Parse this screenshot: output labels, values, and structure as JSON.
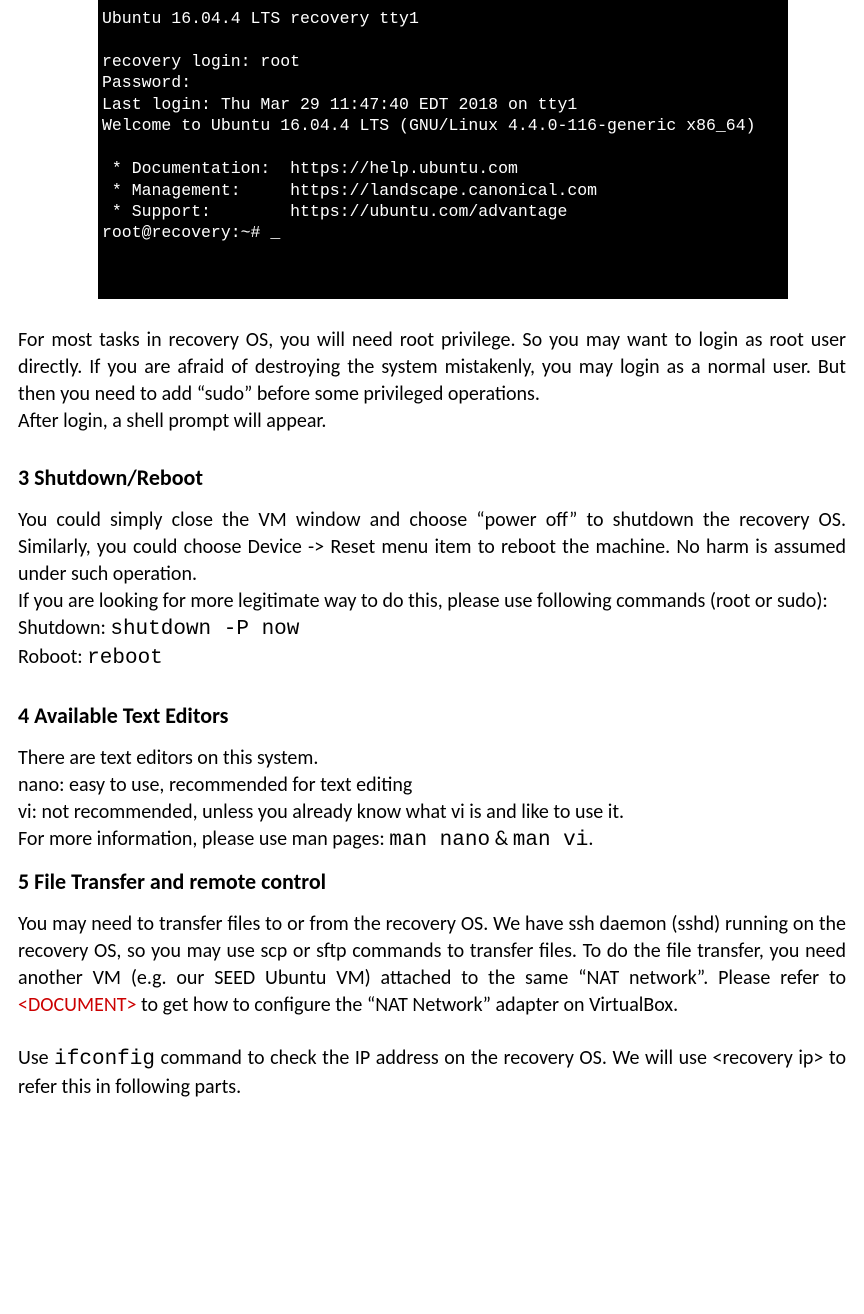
{
  "terminal": "Ubuntu 16.04.4 LTS recovery tty1\n\nrecovery login: root\nPassword:\nLast login: Thu Mar 29 11:47:40 EDT 2018 on tty1\nWelcome to Ubuntu 16.04.4 LTS (GNU/Linux 4.4.0-116-generic x86_64)\n\n * Documentation:  https://help.ubuntu.com\n * Management:     https://landscape.canonical.com\n * Support:        https://ubuntu.com/advantage\nroot@recovery:~# _",
  "intro_p1": "For most tasks in recovery OS, you will need root privilege. So you may want to login as root user directly. If you are afraid of destroying the system mistakenly, you may login as a normal user. But then you need to add “sudo” before some privileged operations.",
  "intro_p2": "After login, a shell prompt will appear.",
  "sec3": {
    "heading": "3 Shutdown/Reboot",
    "p1": "You could simply close the VM window and choose “power off” to shutdown the recovery OS. Similarly, you could choose Device -> Reset menu item to reboot the machine. No harm is assumed under such operation.",
    "p2": "If you are looking for more legitimate way to do this, please use following commands (root or sudo):",
    "shutdown_label": "Shutdown: ",
    "shutdown_cmd": "shutdown -P now",
    "reboot_label": "Roboot: ",
    "reboot_cmd": "reboot"
  },
  "sec4": {
    "heading": "4 Available Text Editors",
    "p1": "There are text editors on this system.",
    "p2": "nano: easy to use, recommended for text editing",
    "p3": "vi: not recommended, unless you already know what vi is and like to use it.",
    "p4a": "For more information, please use man pages: ",
    "cmd1": "man nano",
    "amp": " & ",
    "cmd2": "man vi",
    "period": "."
  },
  "sec5": {
    "heading": "5 File Transfer and remote control",
    "p1a": "You may need to transfer files to or from the recovery OS. We have ssh daemon (sshd) running on the recovery OS, so you may use scp or sftp commands to transfer files. To do the file transfer, you need another VM (e.g. our SEED Ubuntu VM) attached to the same “NAT network”. Please refer to ",
    "doclink": "<DOCUMENT>",
    "p1b": " to get how to configure the “NAT Network” adapter on VirtualBox.",
    "p2a": "Use ",
    "cmd": "ifconfig",
    "p2b": " command to check the IP address on the recovery OS. We will use <recovery ip> to refer this in following parts."
  }
}
